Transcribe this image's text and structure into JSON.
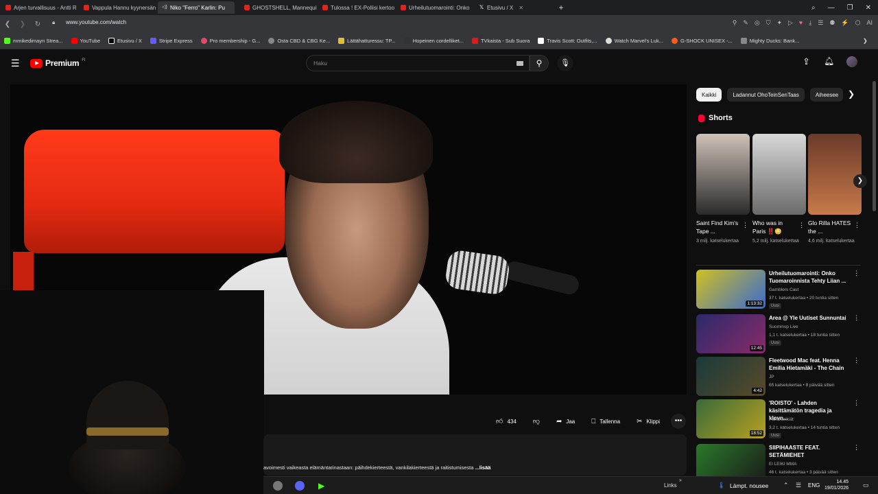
{
  "browser": {
    "tabs": [
      {
        "label": "Arjen turvallisuus - Antti R"
      },
      {
        "label": "Vappula Hannu kyynersän"
      },
      {
        "label": "Niko \"Ferro\" Karlin: Pu",
        "active": true
      },
      {
        "label": "GHOSTSHELL, Mannequin"
      },
      {
        "label": "Tulossa ! EX-Poliisi kertoo"
      },
      {
        "label": "Urheilutuomarointi: Onko"
      },
      {
        "label": "Etusivu / X"
      }
    ],
    "url": "www.youtube.com/watch",
    "bookmarks": [
      {
        "label": "mmikedimayn Strea...",
        "color": "#53fc18"
      },
      {
        "label": "YouTube",
        "color": "#ff0000"
      },
      {
        "label": "Etusivu / X",
        "color": "#ffffff"
      },
      {
        "label": "Stripe Express",
        "color": "#635bff"
      },
      {
        "label": "Pro membership - G...",
        "color": "#e04a6b"
      },
      {
        "label": "Osta CBD & CBG Ke...",
        "color": "#888888"
      },
      {
        "label": "Lättähatturessu: TP...",
        "color": "#e0c030"
      },
      {
        "label": "Hopeinen cordelliket...",
        "color": "#333333"
      },
      {
        "label": "TVkaista - Sub Suora",
        "color": "#d02020"
      },
      {
        "label": "Travis Scott: Outfits,...",
        "color": "#ffffff"
      },
      {
        "label": "Watch Marvel's Luk...",
        "color": "#dddddd"
      },
      {
        "label": "G-SHOCK UNISEX -...",
        "color": "#ff5a1a"
      },
      {
        "label": "Mighty Ducks: Bank...",
        "color": "#888888"
      }
    ]
  },
  "youtube": {
    "logo": "Premium",
    "logo_cc": "FI",
    "search_placeholder": "Haku",
    "actions": {
      "likes": "434",
      "share": "Jaa",
      "save": "Tallenna",
      "clip": "Klippi"
    },
    "description": "avoimesti vaikeasta elämäntarinastaan: päihdekierteestä, vankilakierteestä ja raitistumisesta",
    "description_more": "...lisää",
    "chips": [
      "Kaikki",
      "Ladannut OhoTeinSenTaas",
      "Aiheesee"
    ],
    "shorts_title": "Shorts",
    "shorts": [
      {
        "title": "Saint Find Kim's Tape ...",
        "views": "3 milj. katselukertaa",
        "c1": "#cfc2b8",
        "c2": "#2a2a2a"
      },
      {
        "title": "Who was in Paris ‼️😳",
        "views": "5,2 milj. katselukertaa",
        "c1": "#d8d8d8",
        "c2": "#6a6a6a"
      },
      {
        "title": "Glo Rilla HATES the ...",
        "views": "4,6 milj. katselukertaa",
        "c1": "#6a3a2a",
        "c2": "#c87a4a"
      }
    ],
    "videos": [
      {
        "title": "Urheilutuomarointi: Onko Tuomaroinnista Tehty Liian ...",
        "channel": "Gamblers Cast",
        "meta": "37 t. katselukertaa • 20 tuntia sitten",
        "badge": "Uusi",
        "duration": "1:13:32",
        "c1": "#d0c020",
        "c2": "#3a6ad0"
      },
      {
        "title": "Area @ Yle Uutiset Sunnuntai",
        "channel": "Suominsp Live",
        "meta": "1,1 t. katselukertaa • 18 tuntia sitten",
        "badge": "Uusi",
        "duration": "12:45",
        "c1": "#2a2a6a",
        "c2": "#8a2a6a"
      },
      {
        "title": "Fleetwood Mac feat. Henna Emilia Hietamäki - The Chain",
        "channel": "JP",
        "meta": "65 katselukertaa • 8 päivää sitten",
        "badge": "",
        "duration": "4:42",
        "c1": "#1a3a3a",
        "c2": "#5a4a2a"
      },
      {
        "title": "'ROISTO' - Lahden käsittämätön tragedia ja klovn...",
        "channel": "Pahanteikiät",
        "meta": "3,2 t. katselukertaa • 14 tuntia sitten",
        "badge": "Uusi",
        "duration": "18:52",
        "c1": "#3a6a3a",
        "c2": "#b8a020"
      },
      {
        "title": "SIIPIHAASTE FEAT. SETÄMIEHET",
        "channel": "El LEIKI MMA",
        "meta": "46 t. katselukertaa • 3 päivää sitten",
        "badge": "",
        "duration": "",
        "c1": "#2a7a2a",
        "c2": "#1a1a1a"
      }
    ]
  },
  "taskbar": {
    "links": "Links",
    "weather": "Lämpt. nousee",
    "lang": "ENG",
    "time": "14.45",
    "date": "19/01/2026"
  }
}
